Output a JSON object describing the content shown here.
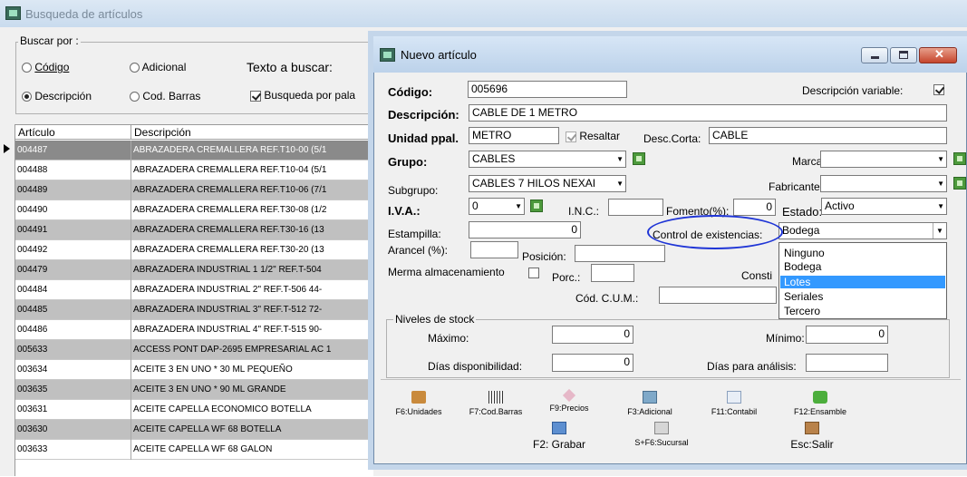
{
  "search_window": {
    "title": "Busqueda de artículos",
    "group_label": "Buscar por :",
    "radios": [
      {
        "label": "Código",
        "checked": false
      },
      {
        "label": "Adicional",
        "checked": false
      },
      {
        "label": "Descripción",
        "checked": true
      },
      {
        "label": "Cod. Barras",
        "checked": false
      }
    ],
    "texto_label": "Texto a buscar:",
    "busqueda_label": "Busqueda por pala",
    "busqueda_checked": true,
    "grid": {
      "columns": [
        "Artículo",
        "Descripción"
      ],
      "rows": [
        [
          "004487",
          "ABRAZADERA CREMALLERA REF.T10-00  (5/1"
        ],
        [
          "004488",
          "ABRAZADERA CREMALLERA REF.T10-04  (5/1"
        ],
        [
          "004489",
          "ABRAZADERA CREMALLERA REF.T10-06  (7/1"
        ],
        [
          "004490",
          "ABRAZADERA CREMALLERA REF.T30-08  (1/2"
        ],
        [
          "004491",
          "ABRAZADERA CREMALLERA REF.T30-16  (13"
        ],
        [
          "004492",
          "ABRAZADERA CREMALLERA REF.T30-20  (13"
        ],
        [
          "004479",
          "ABRAZADERA INDUSTRIAL 1 1/2\" REF.T-504"
        ],
        [
          "004484",
          "ABRAZADERA INDUSTRIAL 2\" REF.T-506  44-"
        ],
        [
          "004485",
          "ABRAZADERA INDUSTRIAL 3\" REF.T-512  72-"
        ],
        [
          "004486",
          "ABRAZADERA INDUSTRIAL 4\" REF.T-515  90-"
        ],
        [
          "005633",
          "ACCESS PONT DAP-2695 EMPRESARIAL AC 1"
        ],
        [
          "003634",
          "ACEITE 3 EN UNO * 30 ML PEQUEÑO"
        ],
        [
          "003635",
          "ACEITE 3 EN UNO * 90 ML GRANDE"
        ],
        [
          "003631",
          "ACEITE CAPELLA ECONOMICO BOTELLA"
        ],
        [
          "003630",
          "ACEITE CAPELLA WF 68 BOTELLA"
        ],
        [
          "003633",
          "ACEITE CAPELLA WF 68 GALON"
        ]
      ]
    }
  },
  "dialog": {
    "title": "Nuevo artículo",
    "codigo_label": "Código:",
    "codigo_value": "005696",
    "desc_variable_label": "Descripción variable:",
    "descripcion_label": "Descripción:",
    "descripcion_value": "CABLE DE 1 METRO",
    "unidad_label": "Unidad ppal.",
    "unidad_value": "METRO",
    "resaltar_label": "Resaltar",
    "desc_corta_label": "Desc.Corta:",
    "desc_corta_value": "CABLE",
    "grupo_label": "Grupo:",
    "grupo_value": "CABLES",
    "marca_label": "Marca:",
    "subgrupo_label": "Subgrupo:",
    "subgrupo_value": "CABLES 7 HILOS NEXAI",
    "fabricante_label": "Fabricante:",
    "iva_label": "I.V.A.:",
    "iva_value": "0",
    "inc_label": "I.N.C.:",
    "fomento_label": "Fomento(%):",
    "fomento_value": "0",
    "estado_label": "Estado:",
    "estado_value": "Activo",
    "estampilla_label": "Estampilla:",
    "estampilla_value": "0",
    "control_label": "Control de existencias:",
    "control_value": "Bodega",
    "control_options": [
      "Ninguno",
      "Bodega",
      "Lotes",
      "Seriales",
      "Tercero"
    ],
    "arancel_label": "Arancel (%):",
    "posicion_label": "Posición:",
    "merma_label": "Merma almacenamiento",
    "porc_label": "Porc.:",
    "consti_label": "Consti",
    "cum_label": "Cód. C.U.M.:",
    "niveles_label": "Niveles de stock",
    "maximo_label": "Máximo:",
    "maximo_value": "0",
    "minimo_label": "Mínimo:",
    "minimo_value": "0",
    "dias_disp_label": "Días disponibilidad:",
    "dias_disp_value": "0",
    "dias_analisis_label": "Días para análisis:",
    "toolbar": {
      "f6": "F6:Unidades",
      "f7": "F7:Cod.Barras",
      "f9": "F9:Precios",
      "f3": "F3:Adicional",
      "f11": "F11:Contabil",
      "f12": "F12:Ensamble",
      "grabar": "F2: Grabar",
      "sucursal": "S+F6:Sucursal",
      "salir": "Esc:Salir"
    }
  },
  "colors": {
    "highlight": "#3399ff",
    "annotation_ellipse": "#1f35d6"
  }
}
